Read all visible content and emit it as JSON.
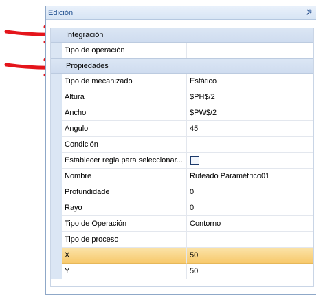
{
  "panel": {
    "title": "Edición",
    "pin_icon": "pin-icon"
  },
  "grid": {
    "categories": [
      "Integración",
      "Propiedades"
    ],
    "integracion": [
      {
        "name": "Tipo de operación",
        "value": ""
      }
    ],
    "propiedades": [
      {
        "name": "Tipo de mecanizado",
        "value": "Estático"
      },
      {
        "name": "Altura",
        "value": "$PH$/2"
      },
      {
        "name": "Ancho",
        "value": "$PW$/2"
      },
      {
        "name": "Angulo",
        "value": "45"
      },
      {
        "name": "Condición",
        "value": ""
      },
      {
        "name": "Establecer regla para seleccionar...",
        "value": ""
      },
      {
        "name": "Nombre",
        "value": "Ruteado Paramétrico01"
      },
      {
        "name": "Profundidade",
        "value": "0"
      },
      {
        "name": "Rayo",
        "value": "0"
      },
      {
        "name": "Tipo de Operación",
        "value": "Contorno"
      },
      {
        "name": "Tipo de proceso",
        "value": ""
      },
      {
        "name": "X",
        "value": "50"
      },
      {
        "name": "Y",
        "value": "50"
      }
    ]
  },
  "annotations": {
    "arrow_color": "#e4151b",
    "selection_color": "#f7c96c"
  }
}
